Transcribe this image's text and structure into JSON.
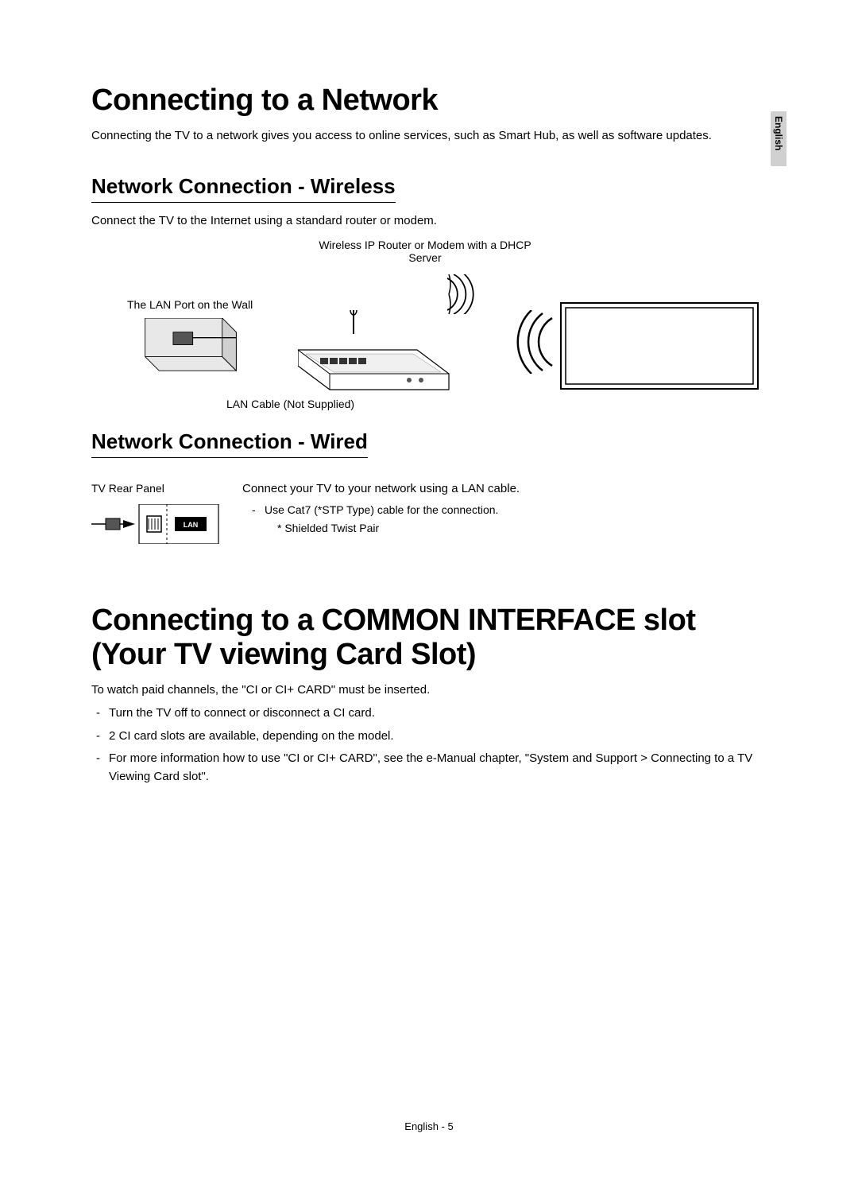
{
  "langTab": "English",
  "section1": {
    "heading": "Connecting to a Network",
    "intro": "Connecting the TV to a network gives you access to online services, such as Smart Hub, as well as software updates.",
    "wireless": {
      "heading": "Network Connection - Wireless",
      "intro": "Connect the TV to the Internet using a standard router or modem.",
      "labels": {
        "router": "Wireless IP Router or Modem with a DHCP Server",
        "wallPort": "The LAN Port on the Wall",
        "lanCable": "LAN Cable (Not Supplied)"
      }
    },
    "wired": {
      "heading": "Network Connection - Wired",
      "rearPanel": "TV Rear Panel",
      "lanBadge": "LAN",
      "mainLine": "Connect your TV to your network using a LAN cable.",
      "bullet": "Use Cat7 (*STP Type) cable for the connection.",
      "subNote": "* Shielded Twist Pair"
    }
  },
  "section2": {
    "heading": "Connecting to a COMMON INTERFACE slot (Your TV viewing Card Slot)",
    "intro": "To watch paid channels, the \"CI or CI+ CARD\" must be inserted.",
    "bullets": [
      "Turn the TV off to connect or disconnect a CI card.",
      "2 CI card slots are available, depending on the model.",
      "For more information how to use \"CI or CI+ CARD\", see the e-Manual chapter, \"System and Support > Connecting to a TV Viewing Card slot\"."
    ]
  },
  "footer": "English - 5"
}
